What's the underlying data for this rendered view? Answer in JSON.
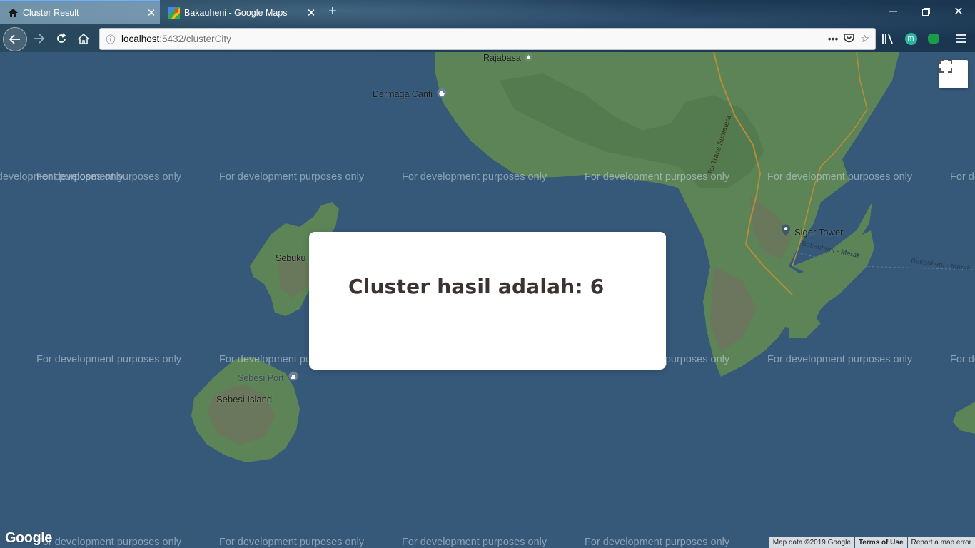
{
  "browser": {
    "tabs": [
      {
        "title": "Cluster Result",
        "icon": "home-icon",
        "active": true
      },
      {
        "title": "Bakauheni - Google Maps",
        "icon": "google-maps-icon",
        "active": false
      }
    ],
    "url": {
      "host": "localhost",
      "rest": ":5432/clusterCity"
    }
  },
  "map": {
    "watermark_text": "For development purposes only",
    "places": {
      "rajabasa": "Rajabasa",
      "dermaga_canti": "Dermaga Canti",
      "sebuku": "Sebuku",
      "sebesi_port": "Sebesi Port",
      "sebesi_island": "Sebesi Island",
      "siger_tower": "Siger Tower",
      "bakauheni_merak_1": "Bakauheni - Merak",
      "bakauheni_merak_2": "Bakauheni - Merak",
      "trans_sumatera": "Tol Trans Sumatera"
    },
    "google_logo": "Google",
    "attribution": {
      "map_data": "Map data ©2019 Google",
      "terms": "Terms of Use",
      "report": "Report a map error"
    }
  },
  "modal": {
    "text": "Cluster hasil adalah: 6"
  }
}
